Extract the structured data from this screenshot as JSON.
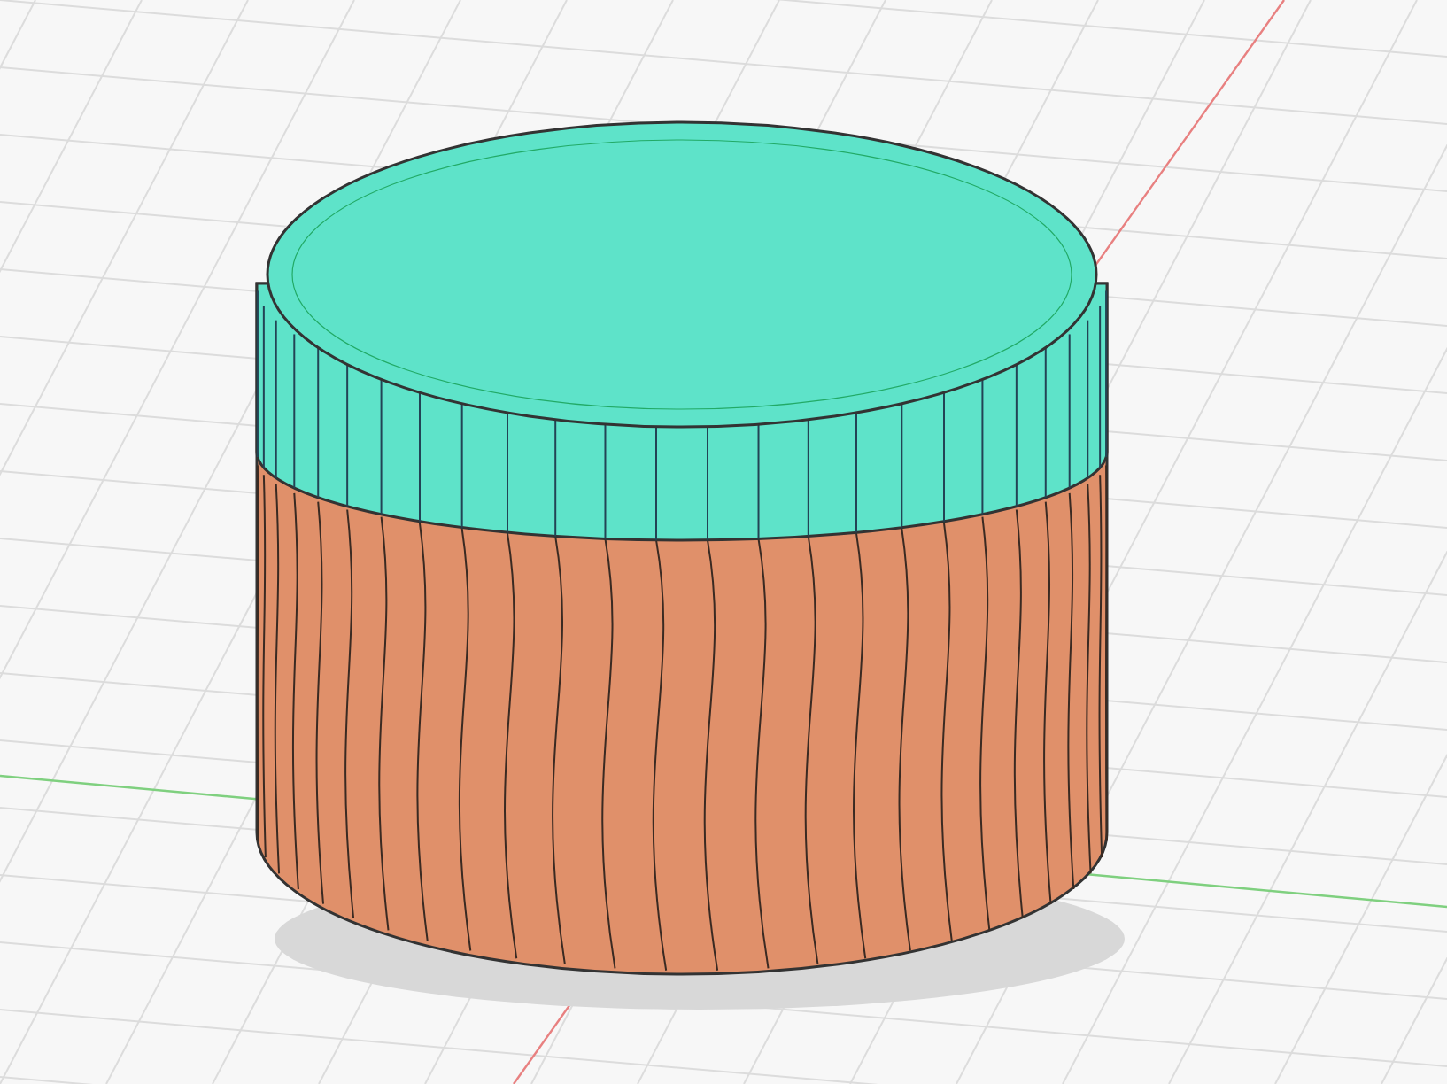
{
  "viewport": {
    "axes": [
      {
        "kind": "x",
        "color": "#e88080"
      },
      {
        "kind": "y",
        "color": "#7fd07f"
      }
    ],
    "parts": [
      {
        "kind": "lid",
        "color": "#5ee3c9"
      },
      {
        "kind": "body",
        "color": "#e0906a"
      }
    ]
  }
}
